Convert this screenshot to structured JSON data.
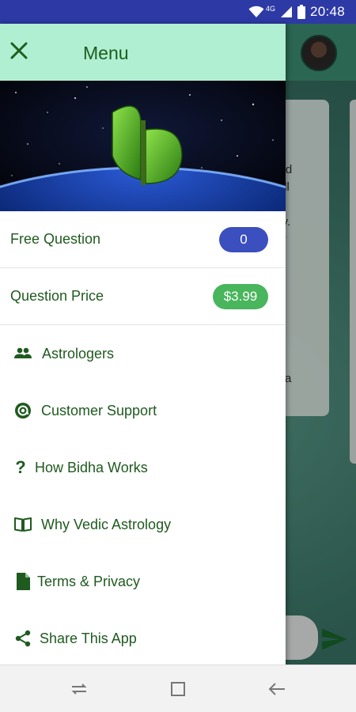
{
  "status_bar": {
    "network": "4G",
    "time": "20:48",
    "icons": [
      "wifi-icon",
      "signal-icon",
      "battery-icon"
    ]
  },
  "background": {
    "bubble_text": "ers\n and\nwell\nlity\nogy.\nour\ns\n\nu\nns.\nd\nite\n a\nas a"
  },
  "drawer": {
    "title": "Menu",
    "free_question": {
      "label": "Free Question",
      "count": "0"
    },
    "question_price": {
      "label": "Question Price",
      "price": "$3.99"
    },
    "items": [
      {
        "label": "Astrologers",
        "icon": "people-icon"
      },
      {
        "label": "Customer Support",
        "icon": "at-sign-icon"
      },
      {
        "label": "How Bidha Works",
        "icon": "question-mark-icon"
      },
      {
        "label": "Why Vedic Astrology",
        "icon": "book-icon"
      },
      {
        "label": "Terms & Privacy",
        "icon": "document-icon"
      },
      {
        "label": "Share This App",
        "icon": "share-icon"
      }
    ]
  },
  "colors": {
    "status_bar": "#2d3aa6",
    "drawer_header": "#b0efd1",
    "text_green": "#1f5a1f",
    "pill_blue": "#3c4fbe",
    "pill_green": "#49b55c"
  }
}
